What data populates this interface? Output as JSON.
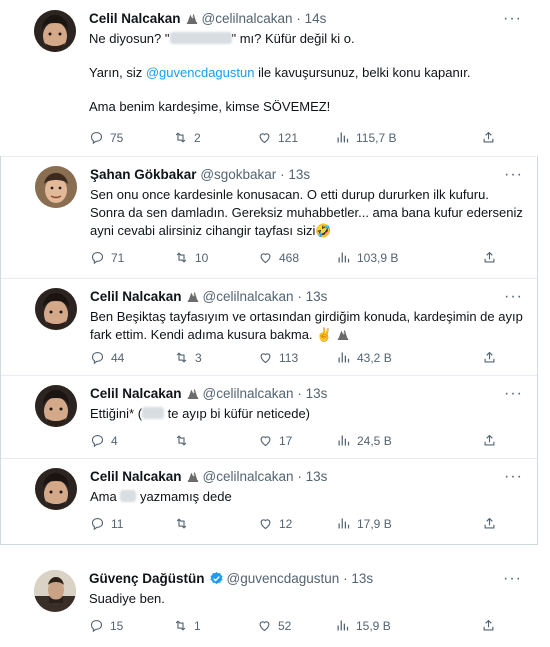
{
  "tweets": [
    {
      "name": "Celil Nalcakan",
      "handle": "@celilnalcakan",
      "time": "14s",
      "text_a": "Ne diyosun? \"",
      "text_b": "\" mı? Küfür değil ki o.",
      "text_c": "Yarın, siz ",
      "mention": "@guvencdagustun",
      "text_d": " ile kavuşursunuz, belki konu kapanır.",
      "text_e": "Ama benim kardeşime, kimse SÖVEMEZ!",
      "replies": "75",
      "retweets": "2",
      "likes": "121",
      "views": "115,7 B"
    },
    {
      "name": "Şahan Gökbakar",
      "handle": "@sgokbakar",
      "time": "13s",
      "text": "Sen onu once kardesinle konusacan. O etti durup dururken ilk kufuru. Sonra da sen damladın. Gereksiz muhabbetler... ama bana kufur ederseniz ayni cevabi alirsiniz cihangir tayfası sizi🤣",
      "replies": "71",
      "retweets": "10",
      "likes": "468",
      "views": "103,9 B"
    },
    {
      "name": "Celil Nalcakan",
      "handle": "@celilnalcakan",
      "time": "13s",
      "text": "Ben Beşiktaş tayfasıyım ve ortasından girdiğim konuda, kardeşimin de ayıp fark ettim. Kendi adıma kusura bakma. ✌️",
      "replies": "44",
      "retweets": "3",
      "likes": "113",
      "views": "43,2 B"
    },
    {
      "name": "Celil Nalcakan",
      "handle": "@celilnalcakan",
      "time": "13s",
      "text_a": "Ettiğini* (",
      "text_b": " te ayıp bi küfür neticede)",
      "replies": "4",
      "likes": "17",
      "views": "24,5 B"
    },
    {
      "name": "Celil Nalcakan",
      "handle": "@celilnalcakan",
      "time": "13s",
      "text_a": "Ama ",
      "text_b": " yazmamış dede",
      "replies": "11",
      "likes": "12",
      "views": "17,9 B"
    },
    {
      "name": "Güvenç Dağüstün",
      "handle": "@guvencdagustun",
      "time": "13s",
      "text": "Suadiye ben.",
      "replies": "15",
      "retweets": "1",
      "likes": "52",
      "views": "15,9 B"
    }
  ],
  "ui": {
    "dot": "·",
    "more": "···"
  },
  "icons": [
    "reply-icon",
    "retweet-icon",
    "like-icon",
    "views-icon",
    "share-icon",
    "verified-icon",
    "more-icon"
  ],
  "colors": {
    "accent": "#1d9bf0",
    "muted": "#536471",
    "text": "#0f1419",
    "border": "#e6ecf0"
  }
}
